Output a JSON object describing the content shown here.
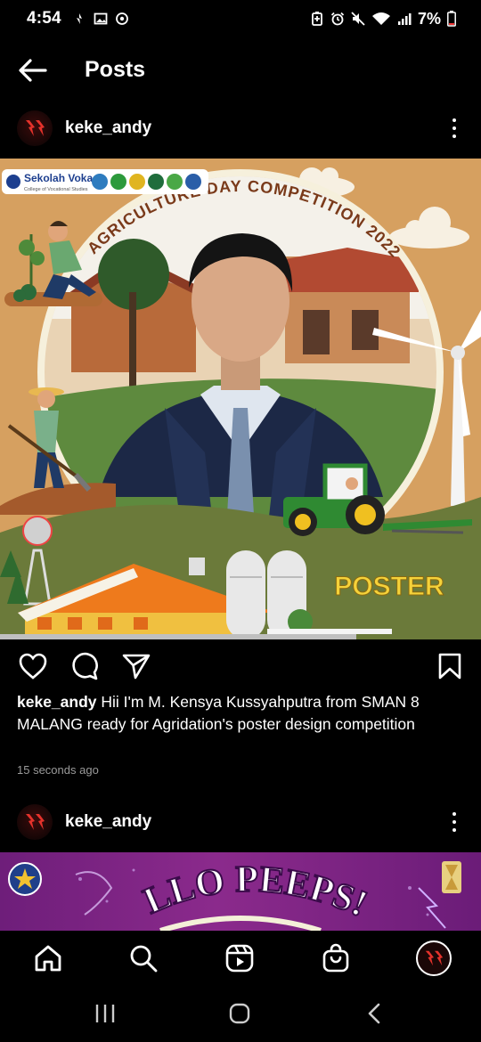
{
  "status_bar": {
    "time": "4:54",
    "battery": "7%",
    "left_icons": [
      "weather-icon",
      "image-icon",
      "sync-icon"
    ],
    "right_icons": [
      "battery-saver-icon",
      "alarm-icon",
      "mute-icon",
      "wifi-icon",
      "signal-icon",
      "battery-icon"
    ]
  },
  "header": {
    "title": "Posts"
  },
  "posts": [
    {
      "username": "keke_andy",
      "image": {
        "logo_text": "Sekolah Vokasi",
        "logo_subtext": "College of Vocational Studies",
        "arc_title": "AGRICULTURE DAY COMPETITION 2022",
        "label": "POSTER"
      },
      "caption_user": "keke_andy",
      "caption_text": "Hii I'm M. Kensya Kussyahputra from SMAN 8 MALANG ready for Agridation's poster design competition",
      "time_ago": "15 seconds ago"
    },
    {
      "username": "keke_andy",
      "image": {
        "headline": "LLO PEEPS!"
      }
    }
  ],
  "colors": {
    "background": "#000000",
    "poster_bg": "#d6a060",
    "poster_label": "#f5d23a",
    "field_green": "#6b7a3a"
  },
  "bottom_nav": [
    "home-icon",
    "search-icon",
    "reels-icon",
    "shop-icon",
    "profile-avatar"
  ],
  "system_nav": [
    "recents-icon",
    "home-pill-icon",
    "back-icon"
  ]
}
